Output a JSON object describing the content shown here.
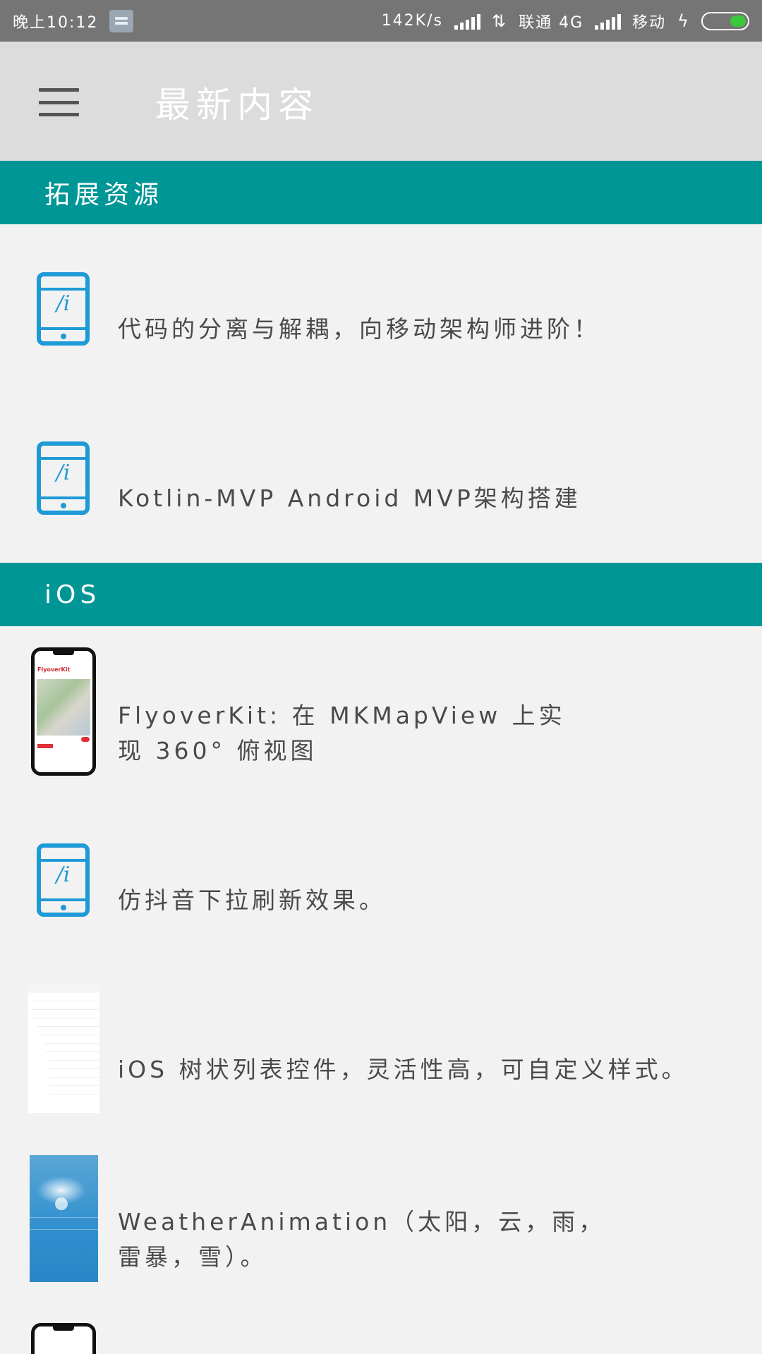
{
  "status_bar": {
    "time": "晚上10:12",
    "speed": "142K/s",
    "carrier1": "联通 4G",
    "carrier2": "移动",
    "battery_level": 0.35,
    "battery_color": "#39c93a"
  },
  "app_bar": {
    "title": "最新内容",
    "menu_icon": "hamburger-menu-icon"
  },
  "colors": {
    "section_header": "#009696",
    "icon_blue": "#1e9ad6",
    "app_bar": "#dcdcdc"
  },
  "sections": [
    {
      "title": "拓展资源",
      "items": [
        {
          "icon": "phone-icon",
          "text": "代码的分离与解耦，向移动架构师进阶！"
        },
        {
          "icon": "phone-icon",
          "text": "Kotlin-MVP Android MVP架构搭建"
        }
      ]
    },
    {
      "title": "iOS",
      "items": [
        {
          "icon": "flyoverkit-thumbnail",
          "text_line1": "FlyoverKit: 在 MKMapView 上实",
          "text_line2": "现 360° 俯视图",
          "thumb_caption": "FlyoverKit"
        },
        {
          "icon": "phone-icon",
          "text": "仿抖音下拉刷新效果。"
        },
        {
          "icon": "tree-list-thumbnail",
          "text": "iOS 树状列表控件，灵活性高，可自定义样式。"
        },
        {
          "icon": "weather-thumbnail",
          "text_line1": "WeatherAnimation（太阳，云，雨，",
          "text_line2": "雷暴，雪）。"
        },
        {
          "icon": "phone-thumbnail"
        }
      ]
    }
  ]
}
